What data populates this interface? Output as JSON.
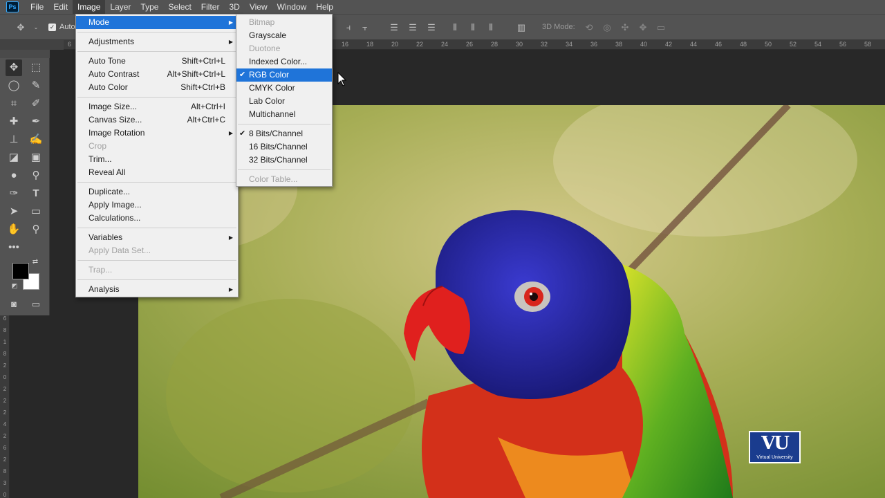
{
  "menubar": {
    "app_icon": "Ps",
    "items": [
      "File",
      "Edit",
      "Image",
      "Layer",
      "Type",
      "Select",
      "Filter",
      "3D",
      "View",
      "Window",
      "Help"
    ],
    "active": "Image"
  },
  "options_bar": {
    "auto_select_label": "Auto-",
    "mode_3d_label": "3D Mode:"
  },
  "ruler": {
    "h_ticks": [
      "6",
      "16",
      "18",
      "20",
      "22",
      "24",
      "26",
      "28",
      "30",
      "32",
      "34",
      "36",
      "38",
      "40",
      "42",
      "44",
      "46",
      "48",
      "50",
      "52",
      "54",
      "56",
      "58"
    ],
    "v_ticks": [
      "6",
      "8",
      "1",
      "8",
      "2",
      "0",
      "2",
      "2",
      "2",
      "4",
      "2",
      "6",
      "2",
      "8",
      "3",
      "0"
    ]
  },
  "image_menu": {
    "items": [
      {
        "label": "Mode",
        "shortcut": "",
        "submenu": true,
        "highlighted": true,
        "disabled": false
      },
      {
        "sep": true
      },
      {
        "label": "Adjustments",
        "shortcut": "",
        "submenu": true,
        "disabled": false
      },
      {
        "sep": true
      },
      {
        "label": "Auto Tone",
        "shortcut": "Shift+Ctrl+L",
        "disabled": false
      },
      {
        "label": "Auto Contrast",
        "shortcut": "Alt+Shift+Ctrl+L",
        "disabled": false
      },
      {
        "label": "Auto Color",
        "shortcut": "Shift+Ctrl+B",
        "disabled": false
      },
      {
        "sep": true
      },
      {
        "label": "Image Size...",
        "shortcut": "Alt+Ctrl+I",
        "disabled": false
      },
      {
        "label": "Canvas Size...",
        "shortcut": "Alt+Ctrl+C",
        "disabled": false
      },
      {
        "label": "Image Rotation",
        "shortcut": "",
        "submenu": true,
        "disabled": false
      },
      {
        "label": "Crop",
        "shortcut": "",
        "disabled": true
      },
      {
        "label": "Trim...",
        "shortcut": "",
        "disabled": false
      },
      {
        "label": "Reveal All",
        "shortcut": "",
        "disabled": false
      },
      {
        "sep": true
      },
      {
        "label": "Duplicate...",
        "shortcut": "",
        "disabled": false
      },
      {
        "label": "Apply Image...",
        "shortcut": "",
        "disabled": false
      },
      {
        "label": "Calculations...",
        "shortcut": "",
        "disabled": false
      },
      {
        "sep": true
      },
      {
        "label": "Variables",
        "shortcut": "",
        "submenu": true,
        "disabled": false
      },
      {
        "label": "Apply Data Set...",
        "shortcut": "",
        "disabled": true
      },
      {
        "sep": true
      },
      {
        "label": "Trap...",
        "shortcut": "",
        "disabled": true
      },
      {
        "sep": true
      },
      {
        "label": "Analysis",
        "shortcut": "",
        "submenu": true,
        "disabled": false
      }
    ]
  },
  "mode_menu": {
    "items": [
      {
        "label": "Bitmap",
        "disabled": true,
        "checked": false
      },
      {
        "label": "Grayscale",
        "disabled": false,
        "checked": false
      },
      {
        "label": "Duotone",
        "disabled": true,
        "checked": false
      },
      {
        "label": "Indexed Color...",
        "disabled": false,
        "checked": false
      },
      {
        "label": "RGB Color",
        "disabled": false,
        "checked": true,
        "highlighted": true
      },
      {
        "label": "CMYK Color",
        "disabled": false,
        "checked": false
      },
      {
        "label": "Lab Color",
        "disabled": false,
        "checked": false
      },
      {
        "label": "Multichannel",
        "disabled": false,
        "checked": false
      },
      {
        "sep": true
      },
      {
        "label": "8 Bits/Channel",
        "disabled": false,
        "checked": true
      },
      {
        "label": "16 Bits/Channel",
        "disabled": false,
        "checked": false
      },
      {
        "label": "32 Bits/Channel",
        "disabled": false,
        "checked": false
      },
      {
        "sep": true
      },
      {
        "label": "Color Table...",
        "disabled": true,
        "checked": false
      }
    ]
  },
  "watermark": {
    "logo_text": "VU",
    "caption": "Virtual University"
  },
  "colors": {
    "menu_highlight": "#1f74d9",
    "ui_panel": "#535353",
    "foreground_swatch": "#000000",
    "background_swatch": "#ffffff"
  }
}
